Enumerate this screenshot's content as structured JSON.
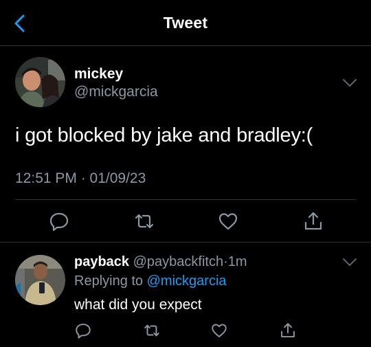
{
  "nav": {
    "title": "Tweet"
  },
  "tweet": {
    "author_name": "mickey",
    "author_handle": "@mickgarcia",
    "text": "i got blocked by jake and bradley:(",
    "timestamp": "12:51 PM · 01/09/23",
    "actions": [
      "reply-icon",
      "retweet-icon",
      "like-icon",
      "share-icon"
    ]
  },
  "reply": {
    "author_name": "payback",
    "author_handle": "@paybackfitch",
    "separator": "·",
    "time": "1m",
    "replying_prefix": "Replying to ",
    "replying_mention": "@mickgarcia",
    "text": "what did you expect"
  },
  "colors": {
    "background": "#000000",
    "accent": "#1d9bf0",
    "muted": "#8b98a5",
    "divider": "#2f3336"
  }
}
